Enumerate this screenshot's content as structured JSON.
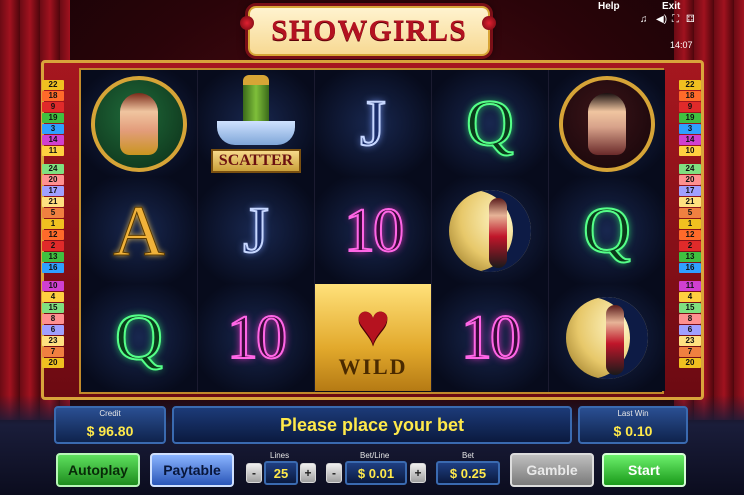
{
  "header": {
    "help_label": "Help",
    "exit_label": "Exit",
    "clock": "14:07",
    "icons": [
      "music-note-icon",
      "speaker-icon",
      "fullscreen-icon",
      "settings-icon"
    ]
  },
  "logo": {
    "title": "SHOWGIRLS",
    "tm": "™"
  },
  "reels": [
    [
      "showgirl-green-portrait",
      "A",
      "Q"
    ],
    [
      "scatter-champagne",
      "J",
      "10"
    ],
    [
      "J",
      "10",
      "wild-heart"
    ],
    [
      "Q",
      "showgirl-moon",
      "10"
    ],
    [
      "showgirl-dark-portrait",
      "Q",
      "showgirl-moon"
    ]
  ],
  "labels": {
    "scatter": "SCATTER",
    "wild": "WILD"
  },
  "paylines": {
    "left": [
      "22",
      "18",
      "9",
      "19",
      "3",
      "14",
      "11",
      "24",
      "20",
      "17",
      "21",
      "5",
      "1",
      "12",
      "2",
      "13",
      "16",
      "10",
      "4",
      "15",
      "8",
      "6",
      "23",
      "7",
      "20"
    ],
    "right": [
      "22",
      "18",
      "9",
      "19",
      "3",
      "14",
      "10",
      "24",
      "20",
      "17",
      "21",
      "5",
      "1",
      "12",
      "2",
      "13",
      "16",
      "11",
      "4",
      "15",
      "8",
      "6",
      "23",
      "7",
      "20"
    ]
  },
  "panel": {
    "credit_label": "Credit",
    "credit_value": "$ 96.80",
    "message": "Please place your bet",
    "lastwin_label": "Last Win",
    "lastwin_value": "$ 0.10"
  },
  "controls": {
    "autoplay_label": "Autoplay",
    "paytable_label": "Paytable",
    "lines_label": "Lines",
    "lines_value": "25",
    "betline_label": "Bet/Line",
    "betline_value": "$ 0.01",
    "bet_label": "Bet",
    "bet_value": "$ 0.25",
    "gamble_label": "Gamble",
    "start_label": "Start",
    "minus": "-",
    "plus": "+"
  },
  "colors": {
    "frame_red": "#a6171f",
    "gold": "#d9a43b",
    "button_green": "#1e8c1e",
    "button_blue": "#2a56b8",
    "value_yellow": "#ffe94a"
  }
}
